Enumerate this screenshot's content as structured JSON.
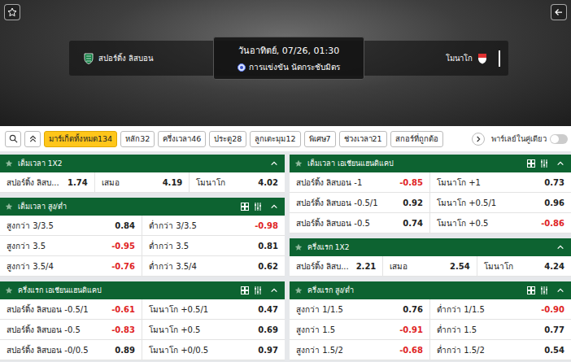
{
  "header": {
    "date": "วันอาทิตย์, 07/26, 01:30",
    "competition": "การแข่งขัน นัดกระชับมิตร",
    "home": "สปอร์ติ้ง ลิสบอน",
    "away": "โมนาโก"
  },
  "toolbar": {
    "tabs": [
      {
        "label": "มาร์เก็ตทั้งหมด",
        "count": "134",
        "selected": true
      },
      {
        "label": "หลัก",
        "count": "32",
        "selected": false
      },
      {
        "label": "ครึ่งเวลา",
        "count": "46",
        "selected": false
      },
      {
        "label": "ประตู",
        "count": "28",
        "selected": false
      },
      {
        "label": "ลูกเตะมุม",
        "count": "12",
        "selected": false
      },
      {
        "label": "พิเศษ",
        "count": "7",
        "selected": false
      },
      {
        "label": "ช่วงเวลา",
        "count": "21",
        "selected": false
      },
      {
        "label": "สกอร์ที่ถูกต้อ",
        "count": "",
        "selected": false
      }
    ],
    "parlay": {
      "label": "พาร์เลย์ในคู่เดียว",
      "on": false
    }
  },
  "columns": [
    [
      {
        "title": "เต็มเวลา 1X2",
        "tools": false,
        "expanded": true,
        "rows": [
          [
            {
              "label": "สปอร์ติ้ง ลิสบ...",
              "odds": "1.74"
            },
            {
              "label": "เสมอ",
              "odds": "4.19"
            },
            {
              "label": "โมนาโก",
              "odds": "4.02"
            }
          ]
        ]
      },
      {
        "title": "เต็มเวลา สูง/ต่ำ",
        "tools": true,
        "expanded": true,
        "rows": [
          [
            {
              "label": "สูงกว่า 3/3.5",
              "odds": "0.84"
            },
            {
              "label": "ต่ำกว่า 3/3.5",
              "odds": "-0.98"
            }
          ],
          [
            {
              "label": "สูงกว่า 3.5",
              "odds": "-0.95"
            },
            {
              "label": "ต่ำกว่า 3.5",
              "odds": "0.81"
            }
          ],
          [
            {
              "label": "สูงกว่า 3.5/4",
              "odds": "-0.76"
            },
            {
              "label": "ต่ำกว่า 3.5/4",
              "odds": "0.62"
            }
          ]
        ]
      },
      {
        "title": "ครึ่งแรก เอเชียนแฮนดิแคป",
        "tools": true,
        "expanded": true,
        "rows": [
          [
            {
              "label": "สปอร์ติ้ง ลิสบอน -0.5/1",
              "odds": "-0.61"
            },
            {
              "label": "โมนาโก +0.5/1",
              "odds": "0.47"
            }
          ],
          [
            {
              "label": "สปอร์ติ้ง ลิสบอน -0.5",
              "odds": "-0.83"
            },
            {
              "label": "โมนาโก +0.5",
              "odds": "0.69"
            }
          ],
          [
            {
              "label": "สปอร์ติ้ง ลิสบอน -0/0.5",
              "odds": "0.89"
            },
            {
              "label": "โมนาโก +0/0.5",
              "odds": "0.97"
            }
          ]
        ]
      }
    ],
    [
      {
        "title": "เต็มเวลา เอเชียนแฮนดิแคป",
        "tools": true,
        "expanded": true,
        "rows": [
          [
            {
              "label": "สปอร์ติ้ง ลิสบอน -1",
              "odds": "-0.85"
            },
            {
              "label": "โมนาโก +1",
              "odds": "0.73"
            }
          ],
          [
            {
              "label": "สปอร์ติ้ง ลิสบอน -0.5/1",
              "odds": "0.92"
            },
            {
              "label": "โมนาโก +0.5/1",
              "odds": "0.96"
            }
          ],
          [
            {
              "label": "สปอร์ติ้ง ลิสบอน -0.5",
              "odds": "0.74"
            },
            {
              "label": "โมนาโก +0.5",
              "odds": "-0.86"
            }
          ]
        ]
      },
      {
        "title": "ครึ่งแรก 1X2",
        "tools": false,
        "expanded": true,
        "rows": [
          [
            {
              "label": "สปอร์ติ้ง ลิสบ...",
              "odds": "2.21"
            },
            {
              "label": "เสมอ",
              "odds": "2.54"
            },
            {
              "label": "โมนาโก",
              "odds": "4.24"
            }
          ]
        ]
      },
      {
        "title": "ครึ่งแรก สูง/ต่ำ",
        "tools": true,
        "expanded": true,
        "rows": [
          [
            {
              "label": "สูงกว่า 1/1.5",
              "odds": "0.76"
            },
            {
              "label": "ต่ำกว่า 1/1.5",
              "odds": "-0.90"
            }
          ],
          [
            {
              "label": "สูงกว่า 1.5",
              "odds": "-0.91"
            },
            {
              "label": "ต่ำกว่า 1.5",
              "odds": "0.77"
            }
          ],
          [
            {
              "label": "สูงกว่า 1.5/2",
              "odds": "-0.68"
            },
            {
              "label": "ต่ำกว่า 1.5/2",
              "odds": "0.54"
            }
          ]
        ]
      }
    ]
  ]
}
